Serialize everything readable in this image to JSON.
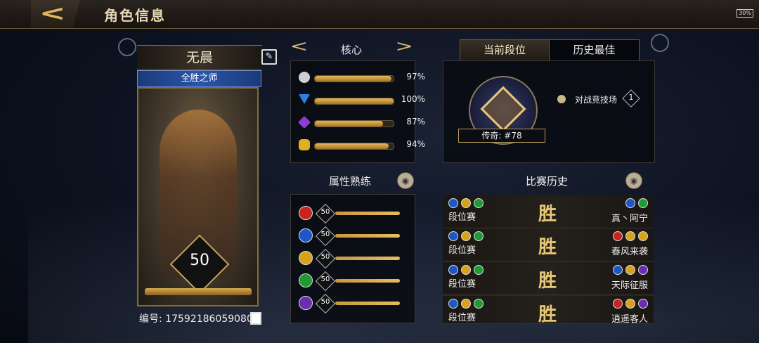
{
  "header": {
    "title": "角色信息",
    "battery": "30%"
  },
  "profile": {
    "name": "无晨",
    "title": "全胜之师",
    "level": "50",
    "id_label": "编号: 17592186059080",
    "xp_progress": 1.0
  },
  "core": {
    "label": "核心",
    "stats": [
      {
        "icon": "silver-orb-icon",
        "color": "#cfcfcf",
        "value": 0.97,
        "label": "97%"
      },
      {
        "icon": "blue-triangle-icon",
        "color": "#2f7fe0",
        "value": 1.0,
        "label": "100%"
      },
      {
        "icon": "purple-diamond-icon",
        "color": "#8a3fd0",
        "value": 0.87,
        "label": "87%"
      },
      {
        "icon": "gold-hexagon-icon",
        "color": "#e0b020",
        "value": 0.94,
        "label": "94%"
      }
    ]
  },
  "mastery": {
    "label": "属性熟练",
    "items": [
      {
        "icon": "red-attribute-icon",
        "color": "#c8241c",
        "level": "50"
      },
      {
        "icon": "blue-attribute-icon",
        "color": "#1d56c6",
        "level": "50"
      },
      {
        "icon": "yellow-attribute-icon",
        "color": "#d7a21a",
        "level": "50"
      },
      {
        "icon": "green-attribute-icon",
        "color": "#1f9a35",
        "level": "50"
      },
      {
        "icon": "purple-attribute-icon",
        "color": "#6a2fb0",
        "level": "50"
      }
    ]
  },
  "rank": {
    "tab_current": "当前段位",
    "tab_best": "历史最佳",
    "rank_label": "传奇: #78",
    "arena_label": "对战竞技场",
    "arena_count": "1"
  },
  "history": {
    "label": "比赛历史",
    "matches": [
      {
        "type": "段位赛",
        "result": "胜",
        "opponent": "真丶阿宁",
        "mine": [
          "#1d56c6",
          "#d7a21a",
          "#1f9a35"
        ],
        "theirs": [
          "#1d56c6",
          "#1f9a35"
        ]
      },
      {
        "type": "段位赛",
        "result": "胜",
        "opponent": "春风来袭",
        "mine": [
          "#1d56c6",
          "#d7a21a",
          "#1f9a35"
        ],
        "theirs": [
          "#c8241c",
          "#d7a21a",
          "#d7a21a"
        ]
      },
      {
        "type": "段位赛",
        "result": "胜",
        "opponent": "天际征服",
        "mine": [
          "#1d56c6",
          "#d7a21a",
          "#1f9a35"
        ],
        "theirs": [
          "#1d56c6",
          "#d7a21a",
          "#6a2fb0"
        ]
      },
      {
        "type": "段位赛",
        "result": "胜",
        "opponent": "逍遥客人",
        "mine": [
          "#1d56c6",
          "#d7a21a",
          "#1f9a35"
        ],
        "theirs": [
          "#c8241c",
          "#d7a21a",
          "#6a2fb0"
        ]
      }
    ]
  }
}
